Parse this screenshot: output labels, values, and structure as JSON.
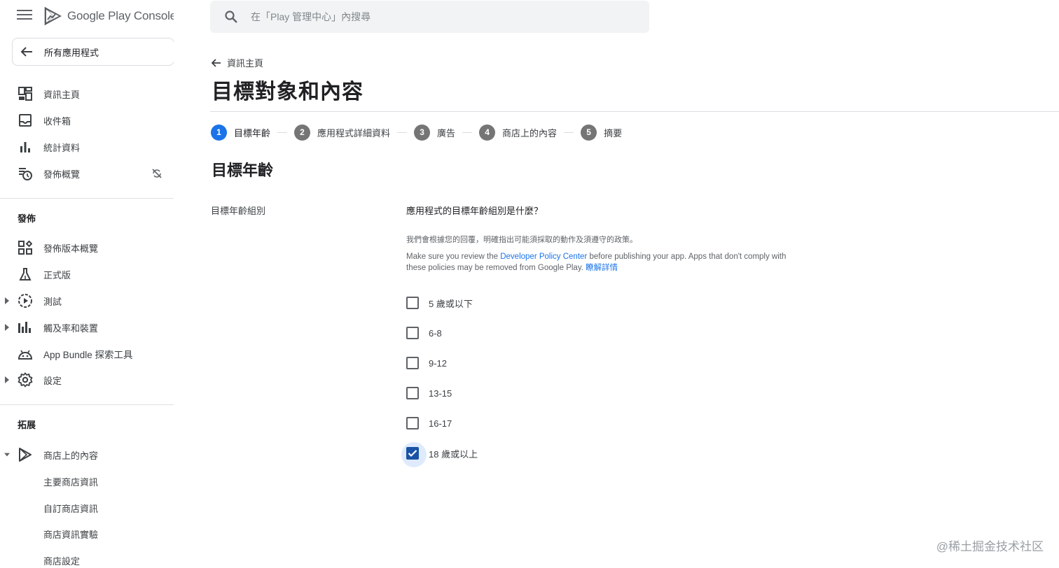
{
  "app": {
    "name": "Google Play Console",
    "all_apps_label": "所有應用程式"
  },
  "sidebar": {
    "top_items": [
      {
        "label": "資訊主頁",
        "icon": "dashboard-icon"
      },
      {
        "label": "收件箱",
        "icon": "inbox-icon"
      },
      {
        "label": "統計資料",
        "icon": "bar-chart-icon"
      },
      {
        "label": "發佈概覽",
        "icon": "publishing-overview-icon",
        "trailing_icon": "sync-disabled-icon"
      }
    ],
    "release_section": {
      "title": "發佈",
      "items": [
        {
          "label": "發佈版本概覽",
          "icon": "releases-overview-icon"
        },
        {
          "label": "正式版",
          "icon": "production-flask-icon"
        },
        {
          "label": "測試",
          "icon": "testing-play-icon",
          "expandable": true
        },
        {
          "label": "觸及率和裝置",
          "icon": "reach-devices-icon",
          "expandable": true
        },
        {
          "label": "App Bundle 探索工具",
          "icon": "android-icon"
        },
        {
          "label": "設定",
          "icon": "gear-icon",
          "expandable": true
        }
      ]
    },
    "grow_section": {
      "title": "拓展",
      "items": [
        {
          "label": "商店上的內容",
          "icon": "play-store-icon",
          "expanded": true
        }
      ],
      "sub_items": [
        {
          "label": "主要商店資訊"
        },
        {
          "label": "自訂商店資訊"
        },
        {
          "label": "商店資訊實驗"
        },
        {
          "label": "商店設定"
        }
      ]
    }
  },
  "search": {
    "placeholder": "在「Play 管理中心」內搜尋",
    "value": ""
  },
  "breadcrumb": {
    "back_label": "資訊主頁"
  },
  "page": {
    "title": "目標對象和內容"
  },
  "stepper": {
    "steps": [
      {
        "number": "1",
        "label": "目標年齡",
        "active": true
      },
      {
        "number": "2",
        "label": "應用程式詳細資料",
        "active": false
      },
      {
        "number": "3",
        "label": "廣告",
        "active": false
      },
      {
        "number": "4",
        "label": "商店上的內容",
        "active": false
      },
      {
        "number": "5",
        "label": "摘要",
        "active": false
      }
    ]
  },
  "section": {
    "heading": "目標年齡",
    "field_label": "目標年齡組別",
    "question": "應用程式的目標年齡組別是什麼？",
    "helper": "我們會根據您的回覆，明確指出可能須採取的動作及須遵守的政策。",
    "policy_before": "Make sure you review the ",
    "policy_link": "Developer Policy Center",
    "policy_after": " before publishing your app. Apps that don't comply with these policies may be removed from Google Play. ",
    "learn_more": "瞭解詳情"
  },
  "age_groups": [
    {
      "label": "5 歲或以下",
      "checked": false
    },
    {
      "label": "6-8",
      "checked": false
    },
    {
      "label": "9-12",
      "checked": false
    },
    {
      "label": "13-15",
      "checked": false
    },
    {
      "label": "16-17",
      "checked": false
    },
    {
      "label": "18 歲或以上",
      "checked": true
    }
  ],
  "watermark": "@稀土掘金技术社区",
  "colors": {
    "accent": "#1a73e8",
    "checkbox_checked": "#1a4e9a",
    "step_inactive": "#757575"
  }
}
